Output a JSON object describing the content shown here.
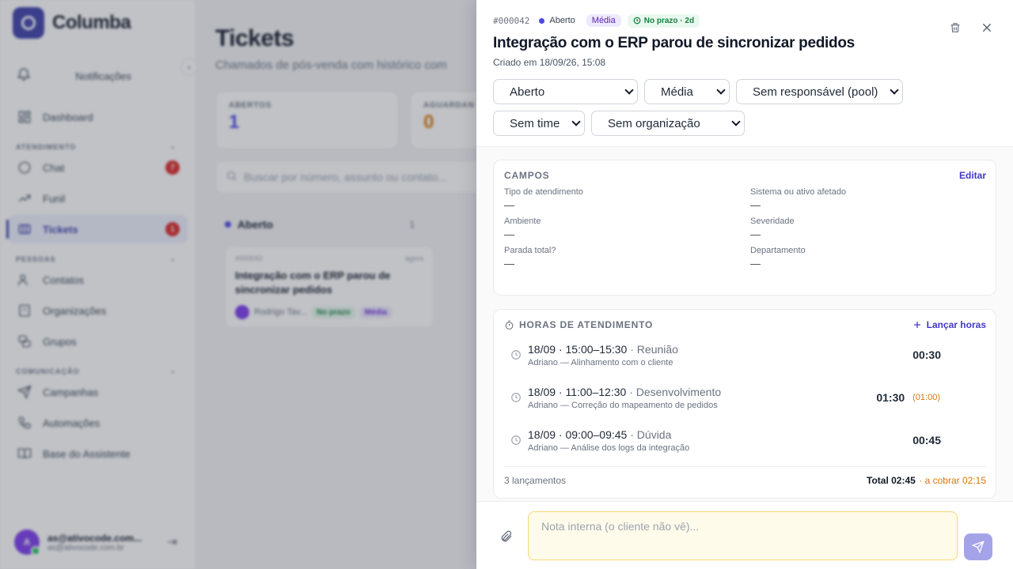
{
  "sidebar": {
    "brand": "Columba",
    "notifications_label": "Notificações",
    "dashboard_label": "Dashboard",
    "sections": [
      {
        "title": "ATENDIMENTO"
      },
      {
        "title": "PESSOAS"
      },
      {
        "title": "COMUNICAÇÃO"
      }
    ],
    "items": {
      "chat": {
        "label": "Chat",
        "badge": "7"
      },
      "funil": {
        "label": "Funil"
      },
      "tickets": {
        "label": "Tickets",
        "badge": "1"
      },
      "contatos": {
        "label": "Contatos"
      },
      "organizacoes": {
        "label": "Organizações"
      },
      "grupos": {
        "label": "Grupos"
      },
      "campanhas": {
        "label": "Campanhas"
      },
      "automacoes": {
        "label": "Automações"
      },
      "base": {
        "label": "Base do Assistente"
      }
    },
    "user": {
      "initial": "A",
      "email": "as@ativocode.com...",
      "sub": "as@ativocode.com.br"
    }
  },
  "main": {
    "title": "Tickets",
    "subtitle": "Chamados de pós-venda com histórico com",
    "stats": [
      {
        "label": "ABERTOS",
        "value": "1",
        "color": "#4f46e5"
      },
      {
        "label": "AGUARDAN",
        "value": "0",
        "color": "#d97706"
      }
    ],
    "search_placeholder": "Buscar por número, assunto ou contato...",
    "columns": [
      {
        "name": "Aberto",
        "count": "1",
        "color": "#4f46e5"
      }
    ],
    "card": {
      "number": "#000042",
      "age": "agora",
      "title": "Integração com o ERP parou de sincronizar pedidos",
      "assignee": "Rodrigo Tav...",
      "sla": "No prazo",
      "priority": "Média"
    }
  },
  "drawer": {
    "number": "#000042",
    "status": "Aberto",
    "priority": "Média",
    "sla": "No prazo · 2d",
    "title": "Integração com o ERP parou de sincronizar pedidos",
    "created": "Criado em 18/09/26, 15:08",
    "selects": {
      "status": "Aberto",
      "priority": "Média",
      "assignee": "Sem responsável (pool)",
      "team": "Sem time",
      "organization": "Sem organização"
    },
    "fields": {
      "title": "CAMPOS",
      "edit": "Editar",
      "items": [
        {
          "label": "Tipo de atendimento",
          "value": "—"
        },
        {
          "label": "Sistema ou ativo afetado",
          "value": "—"
        },
        {
          "label": "Ambiente",
          "value": "—"
        },
        {
          "label": "Severidade",
          "value": "—"
        },
        {
          "label": "Parada total?",
          "value": "—"
        },
        {
          "label": "Departamento",
          "value": "—"
        }
      ]
    },
    "hours": {
      "title": "HORAS DE ATENDIMENTO",
      "add": "Lançar horas",
      "entries": [
        {
          "when": "18/09 · 15:00–15:30",
          "type": "Reunião",
          "desc": "Adriano — Alinhamento com o cliente",
          "duration": "00:30",
          "billable": ""
        },
        {
          "when": "18/09 · 11:00–12:30",
          "type": "Desenvolvimento",
          "desc": "Adriano — Correção do mapeamento de pedidos",
          "duration": "01:30",
          "billable": "(01:00)"
        },
        {
          "when": "18/09 · 09:00–09:45",
          "type": "Dúvida",
          "desc": "Adriano — Análise dos logs da integração",
          "duration": "00:45",
          "billable": ""
        }
      ],
      "count": "3 lançamentos",
      "total": "Total 02:45",
      "to_bill": "· a cobrar 02:15"
    },
    "composer": {
      "placeholder": "Nota interna (o cliente não vê)..."
    }
  }
}
